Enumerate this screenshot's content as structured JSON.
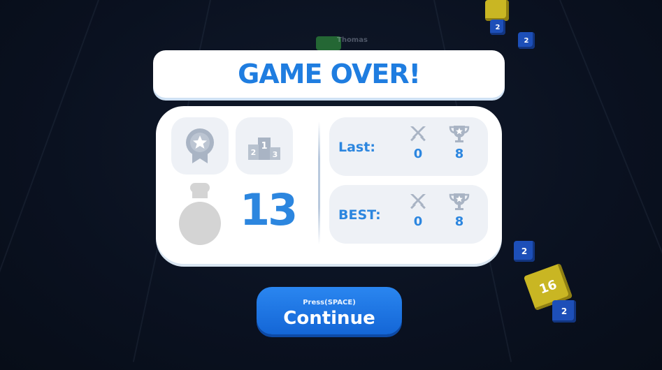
{
  "title": "GAME OVER!",
  "score": "13",
  "stats": {
    "last": {
      "label": "Last:",
      "kills": "0",
      "trophies": "8"
    },
    "best": {
      "label": "BEST:",
      "kills": "0",
      "trophies": "8"
    }
  },
  "continue": {
    "hint": "Press(SPACE)",
    "label": "Continue"
  },
  "background": {
    "player_name": "Thomas",
    "cube_numbers": [
      "2",
      "2",
      "2",
      "2",
      "16"
    ]
  },
  "colors": {
    "accent": "#2c86df",
    "title": "#1f7de0",
    "button": "#1a72e2",
    "tile": "#eef1f6",
    "icon_gray": "#a9b4c4"
  },
  "icons": [
    "medal-icon",
    "podium-icon",
    "coin-bag-icon",
    "crossed-swords-icon",
    "trophy-icon"
  ]
}
